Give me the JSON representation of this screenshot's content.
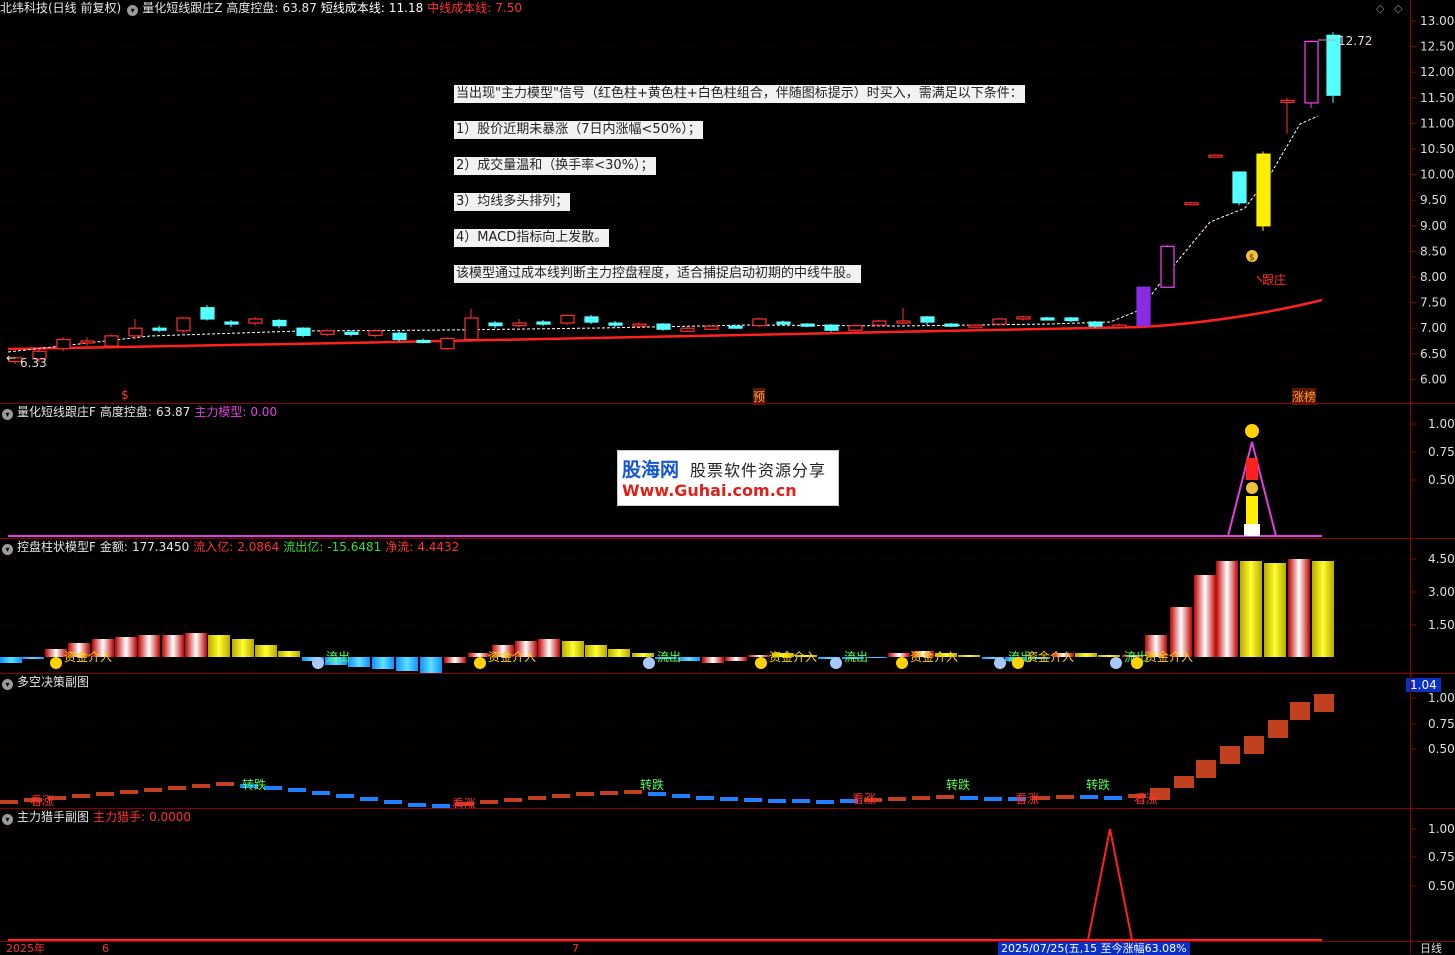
{
  "colors": {
    "up": "#ff3030",
    "down": "#54ffff",
    "cost": "#ffffff",
    "mid": "#ff2020",
    "bg": "#000000",
    "axis": "#8a0000"
  },
  "main": {
    "title": "北纬科技(日线 前复权)",
    "ind_name": "量化短线跟庄Z",
    "ctrl_label": "高度控盘:",
    "ctrl_value": "63.87",
    "short_label": "短线成本线:",
    "short_value": "11.18",
    "mid_label": "中线成本线:",
    "mid_value": "7.50",
    "yticks": [
      "13.00",
      "12.50",
      "12.00",
      "11.50",
      "11.00",
      "10.50",
      "10.00",
      "9.50",
      "9.00",
      "8.50",
      "8.00",
      "7.50",
      "7.00",
      "6.50",
      "6.00"
    ],
    "last_price": "12.72",
    "low_price": "6.33",
    "marker_genzhuang": "跟庄",
    "bottom_tags": [
      "$",
      "预",
      "涨榜"
    ],
    "notes": [
      "当出现\"主力模型\"信号（红色柱+黄色柱+白色柱组合，伴随图标提示）时买入，需满足以下条件：",
      "1）股价近期未暴涨（7日内涨幅<50%）；",
      "2）成交量温和（换手率<30%）；",
      "3）均线多头排列；",
      "4）MACD指标向上发散。",
      "该模型通过成本线判断主力控盘程度，适合捕捉启动初期的中线牛股。"
    ]
  },
  "sub1": {
    "name": "量化短线跟庄F",
    "ctrl_label": "高度控盘:",
    "ctrl_value": "63.87",
    "model_label": "主力模型:",
    "model_value": "0.00",
    "yticks": [
      "1.00",
      "0.75",
      "0.50"
    ]
  },
  "watermark": {
    "brand": "股海网",
    "slogan": "股票软件资源分享",
    "url": "Www.Guhai.com.cn"
  },
  "sub2": {
    "name": "控盘柱状模型F",
    "amt_label": "金额:",
    "amt_value": "177.3450",
    "in_label": "流入亿:",
    "in_value": "2.0864",
    "out_label": "流出亿:",
    "out_value": "-15.6481",
    "net_label": "净流:",
    "net_value": "4.4432",
    "yticks": [
      "4.50",
      "3.00",
      "1.50"
    ],
    "tags": [
      "资金介入",
      "流出",
      "资金介入",
      "流出",
      "资金介入",
      "流出",
      "资金介入",
      "流出",
      "资金介入",
      "流出",
      "资金介入"
    ]
  },
  "sub3": {
    "name": "多空决策副图",
    "yticks": [
      "1.00",
      "0.75",
      "0.50"
    ],
    "current": "1.04",
    "tags": [
      "看涨",
      "转跌",
      "看涨",
      "转跌",
      "看涨",
      "转跌",
      "看涨",
      "转跌",
      "看涨"
    ]
  },
  "sub4": {
    "name": "主力猎手副图",
    "hunter_label": "主力猎手:",
    "hunter_value": "0.0000",
    "yticks": [
      "1.00",
      "0.75",
      "0.50"
    ]
  },
  "footer": {
    "d1": "2025年",
    "d2": "6",
    "d3": "7",
    "info": "2025/07/25(五,15 至今涨幅63.08%",
    "period": "日线"
  }
}
